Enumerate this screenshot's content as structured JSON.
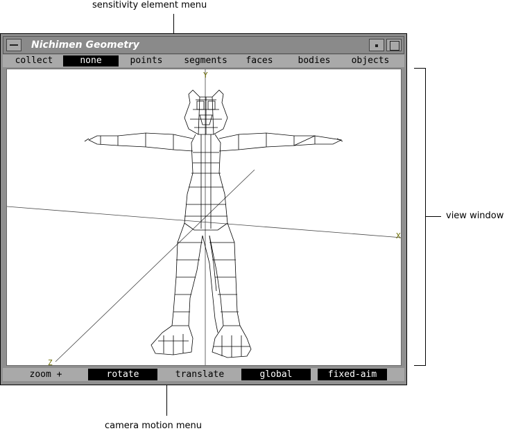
{
  "annotations": {
    "top": "sensitivity element menu",
    "right": "view window",
    "bottom": "camera motion menu"
  },
  "window": {
    "title": "Nichimen Geometry"
  },
  "sensitivity_menu": {
    "items": [
      {
        "label": "collect",
        "selected": false
      },
      {
        "label": "none",
        "selected": true
      },
      {
        "label": "points",
        "selected": false
      },
      {
        "label": "segments",
        "selected": false
      },
      {
        "label": "faces",
        "selected": false
      },
      {
        "label": "bodies",
        "selected": false
      },
      {
        "label": "objects",
        "selected": false
      }
    ]
  },
  "viewport": {
    "axis_labels": {
      "x": "X",
      "y": "Y",
      "z": "Z"
    },
    "axis_label_color": "#6b6b00"
  },
  "camera_menu": {
    "items": [
      {
        "label": "zoom +",
        "selected": false
      },
      {
        "label": "rotate",
        "selected": true
      },
      {
        "label": "translate",
        "selected": false
      },
      {
        "label": "global",
        "selected": true
      },
      {
        "label": "fixed-aim",
        "selected": true
      }
    ]
  }
}
